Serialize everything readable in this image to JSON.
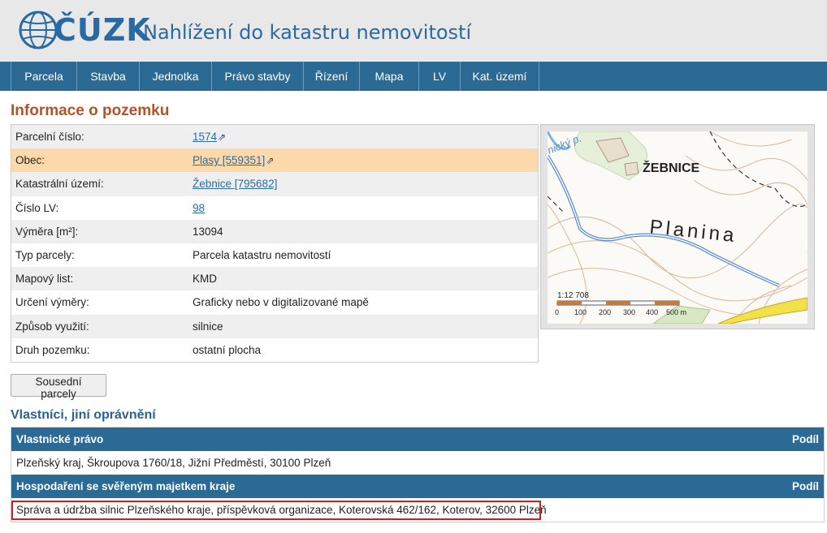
{
  "header": {
    "logo": "ČÚZK",
    "title": "Nahlížení do katastru nemovitostí"
  },
  "nav": [
    "Parcela",
    "Stavba",
    "Jednotka",
    "Právo stavby",
    "Řízení",
    "Mapa",
    "LV",
    "Kat. území"
  ],
  "section_title": "Informace o pozemku",
  "info": {
    "parcelni_cislo": {
      "label": "Parcelní číslo:",
      "value": "1574"
    },
    "obec": {
      "label": "Obec:",
      "value": "Plasy [559351]"
    },
    "katastralni_uzemi": {
      "label": "Katastrální území:",
      "value": "Žebnice [795682]"
    },
    "cislo_lv": {
      "label": "Číslo LV:",
      "value": "98"
    },
    "vymera": {
      "label": "Výměra [m²]:",
      "value": "13094"
    },
    "typ_parcely": {
      "label": "Typ parcely:",
      "value": "Parcela katastru nemovitostí"
    },
    "mapovy_list": {
      "label": "Mapový list:",
      "value": "KMD"
    },
    "urceni_vymery": {
      "label": "Určení výměry:",
      "value": "Graficky nebo v digitalizované mapě"
    },
    "zpusob_vyuziti": {
      "label": "Způsob využití:",
      "value": "silnice"
    },
    "druh_pozemku": {
      "label": "Druh pozemku:",
      "value": "ostatní plocha"
    }
  },
  "map": {
    "place_label": "ŽEBNICE",
    "area_label": "Planina",
    "stream_label": "nický p.",
    "scale_ratio": "1:12 708",
    "scale_ticks": [
      "0",
      "100",
      "200",
      "300",
      "400",
      "500 m"
    ],
    "colors": {
      "road_fill": "#f2e24a",
      "parcel_line": "#5b8bd1",
      "contour": "#d9b79a"
    }
  },
  "buttons": {
    "neighbors": "Sousední parcely"
  },
  "owners_title": "Vlastníci, jiní oprávnění",
  "owners": {
    "group1": {
      "header": "Vlastnické právo",
      "share_label": "Podíl",
      "entry": "Plzeňský kraj, Škroupova 1760/18, Jižní Předměstí, 30100 Plzeň"
    },
    "group2": {
      "header": "Hospodaření se svěřeným majetkem kraje",
      "share_label": "Podíl",
      "entry": "Správa a údržba silnic Plzeňského kraje, příspěvková organizace, Koterovská 462/162, Koterov, 32600 Plzeň"
    }
  },
  "icons": {
    "external": "external-link-icon",
    "logo": "globe-logo-icon"
  }
}
